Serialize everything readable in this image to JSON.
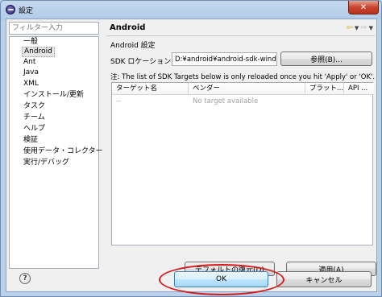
{
  "window": {
    "title": "設定",
    "close_glyph": "✕"
  },
  "filter": {
    "placeholder": "フィルター入力"
  },
  "tree": {
    "items": [
      {
        "label": "一般"
      },
      {
        "label": "Android",
        "selected": true
      },
      {
        "label": "Ant"
      },
      {
        "label": "Java"
      },
      {
        "label": "XML"
      },
      {
        "label": "インストール/更新"
      },
      {
        "label": "タスク"
      },
      {
        "label": "チーム"
      },
      {
        "label": "ヘルプ"
      },
      {
        "label": "検証"
      },
      {
        "label": "使用データ・コレクター"
      },
      {
        "label": "実行/デバッグ"
      }
    ]
  },
  "page": {
    "title": "Android",
    "subtitle": "Android 設定",
    "sdk_label": "SDK ロケーション:",
    "sdk_value": "D:¥android¥android-sdk-windows",
    "browse_button": "参照(B)...",
    "note": "注: The list of SDK Targets below is only reloaded once you hit 'Apply' or 'OK'.",
    "nav": {
      "back": "⇦",
      "dropdown": "▼",
      "forward": "⇨",
      "forward_dropdown": "▼"
    }
  },
  "table": {
    "columns": [
      "ターゲット名",
      "ベンダー",
      "プラット...",
      "API ..."
    ],
    "rows": [
      [
        "--",
        "No target available",
        "",
        ""
      ]
    ]
  },
  "buttons": {
    "restore_defaults": "デフォルトの復元(D)",
    "apply": "適用(A)",
    "ok": "OK",
    "cancel": "キャンセル"
  },
  "help_glyph": "?",
  "colors": {
    "highlight": "#d61a1a",
    "default_button": "#3c7fb1"
  }
}
